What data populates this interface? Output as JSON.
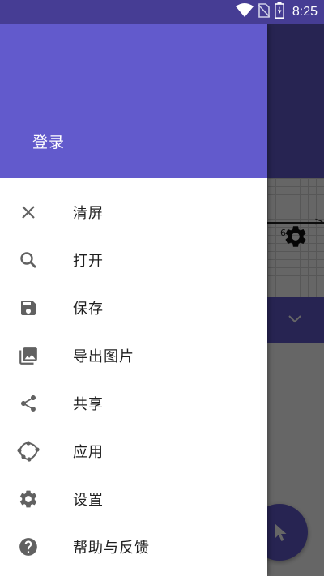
{
  "status_bar": {
    "time": "8:25",
    "icons": [
      "wifi-icon",
      "no-sim-icon",
      "battery-charging-icon"
    ]
  },
  "drawer": {
    "header": {
      "login_label": "登录"
    },
    "menu_items": [
      {
        "label": "清屏",
        "icon": "close-icon"
      },
      {
        "label": "打开",
        "icon": "search-icon"
      },
      {
        "label": "保存",
        "icon": "save-icon"
      },
      {
        "label": "导出图片",
        "icon": "image-export-icon"
      },
      {
        "label": "共享",
        "icon": "share-icon"
      },
      {
        "label": "应用",
        "icon": "apps-polygon-icon"
      },
      {
        "label": "设置",
        "icon": "gear-icon"
      },
      {
        "label": "帮助与反馈",
        "icon": "help-icon"
      }
    ]
  },
  "background_app": {
    "axis_tick_label": "6"
  },
  "colors": {
    "status_bar": "#463d94",
    "primary": "#625acc",
    "icon": "#616161",
    "text": "#1f1f1f",
    "scrim": "rgba(0,0,0,0.6)"
  }
}
